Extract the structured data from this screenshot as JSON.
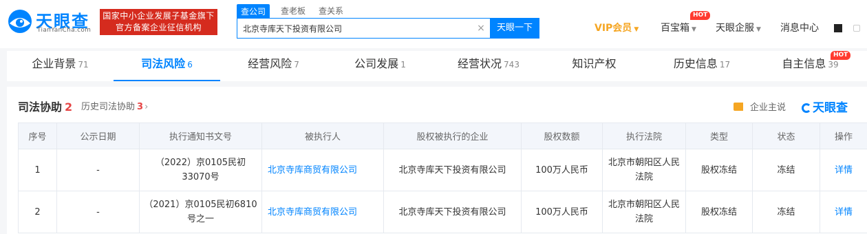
{
  "logo": {
    "name": "天眼查",
    "domain": "TianYanCha.com",
    "brand_color": "#0084ff"
  },
  "banner": {
    "line1": "国家中小企业发展子基金旗下",
    "line2": "官方备案企业征信机构",
    "color": "#d52b1e"
  },
  "search": {
    "tabs": [
      "查公司",
      "查老板",
      "查关系"
    ],
    "query": "北京寺库天下投资有限公司",
    "button": "天眼一下"
  },
  "nav": {
    "vip": "VIP会员",
    "treasure": "百宝箱",
    "treasure_badge": "HOT",
    "enterprise": "天眼企服",
    "messages": "消息中心"
  },
  "categories": [
    {
      "label": "企业背景",
      "count": "71"
    },
    {
      "label": "司法风险",
      "count": "6"
    },
    {
      "label": "经营风险",
      "count": "7"
    },
    {
      "label": "公司发展",
      "count": "1"
    },
    {
      "label": "经营状况",
      "count": "743"
    },
    {
      "label": "知识产权",
      "count": ""
    },
    {
      "label": "历史信息",
      "count": "17"
    },
    {
      "label": "自主信息",
      "count": "39",
      "badge": "HOT"
    }
  ],
  "active_category": "司法风险",
  "section": {
    "title": "司法协助",
    "count": "2",
    "history_label": "历史司法协助",
    "history_count": "3",
    "speak_label": "企业主说",
    "brand_label": "天眼查"
  },
  "table": {
    "columns": [
      "序号",
      "公示日期",
      "执行通知书文号",
      "被执行人",
      "股权被执行的企业",
      "股权数额",
      "执行法院",
      "类型",
      "状态",
      "操作"
    ],
    "rows": [
      {
        "no": "1",
        "date": "-",
        "doc": "（2022）京0105民初33070号",
        "executed": "北京寺库商贸有限公司",
        "company": "北京寺库天下投资有限公司",
        "amount": "100万人民币",
        "court": "北京市朝阳区人民法院",
        "type": "股权冻结",
        "status": "冻结",
        "action": "详情"
      },
      {
        "no": "2",
        "date": "-",
        "doc": "（2021）京0105民初6810号之一",
        "executed": "北京寺库商贸有限公司",
        "company": "北京寺库天下投资有限公司",
        "amount": "100万人民币",
        "court": "北京市朝阳区人民法院",
        "type": "股权冻结",
        "status": "冻结",
        "action": "详情"
      }
    ]
  }
}
